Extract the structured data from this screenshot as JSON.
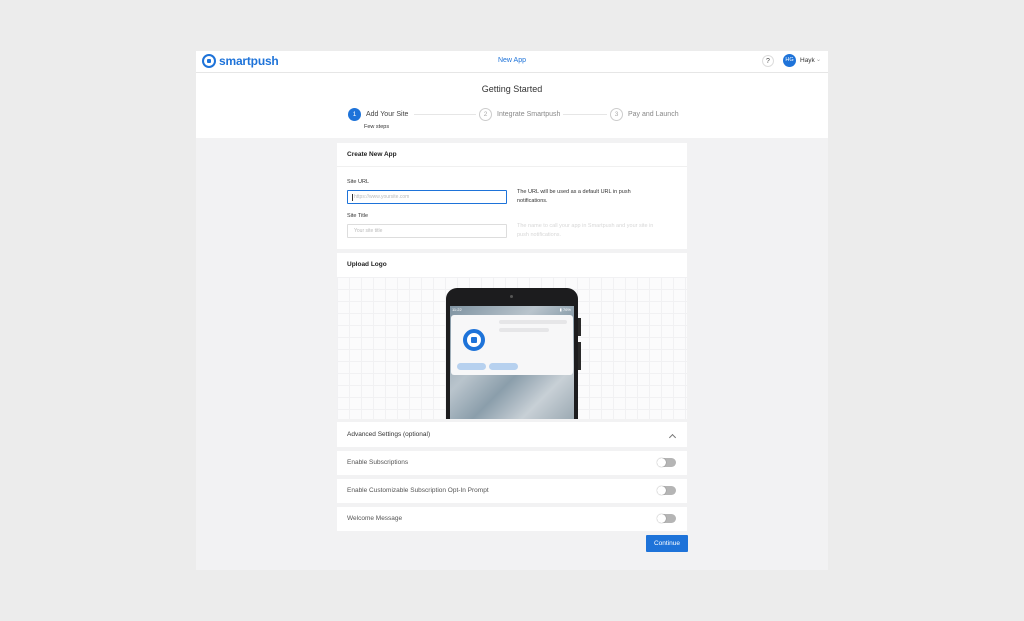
{
  "topbar": {
    "logo_text": "smartpush",
    "center_link": "New App",
    "help_label": "?",
    "avatar_initials": "HG",
    "user_name": "Hayk"
  },
  "header": {
    "title": "Getting Started",
    "steps": [
      {
        "number": "1",
        "label": "Add Your Site",
        "state": "active"
      },
      {
        "number": "2",
        "label": "Integrate Smartpush",
        "state": "inactive"
      },
      {
        "number": "3",
        "label": "Pay and Launch",
        "state": "inactive"
      }
    ],
    "step_sub": "Few steps"
  },
  "create_app": {
    "title": "Create New App",
    "site_url_label": "Site URL",
    "site_url_placeholder": "https://www.yoursite.com",
    "site_url_value": "",
    "site_url_hint": "The URL will be used as a default URL in push notifications.",
    "site_title_label": "Site Title",
    "site_title_placeholder": "Your site title",
    "site_title_value": "",
    "site_title_hint": "The name to call your app in Smartpush and your site in push notifications."
  },
  "upload_logo": {
    "title": "Upload Logo",
    "phone_time": "11:22",
    "phone_battery": "▮ 76%"
  },
  "advanced": {
    "title": "Advanced Settings (optional)",
    "settings": [
      {
        "label": "Enable Subscriptions",
        "enabled": false
      },
      {
        "label": "Enable Customizable Subscription Opt-In Prompt",
        "enabled": false
      },
      {
        "label": "Welcome Message",
        "enabled": false
      }
    ]
  },
  "actions": {
    "continue_label": "Continue"
  },
  "colors": {
    "accent": "#1e73d9",
    "toggle_off": "#b5b5b5",
    "page_bg": "#ececec"
  }
}
